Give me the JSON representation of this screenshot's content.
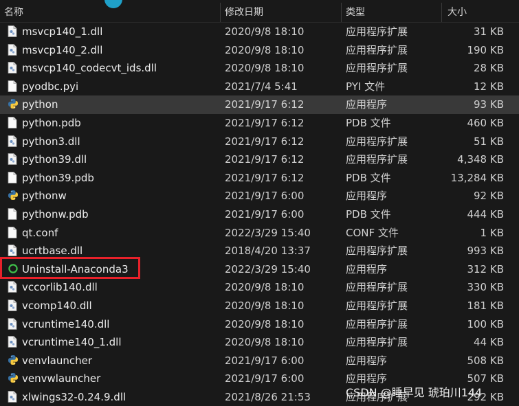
{
  "columns": {
    "name": "名称",
    "date": "修改日期",
    "type": "类型",
    "size": "大小"
  },
  "files": [
    {
      "name": "msvcp140_1.dll",
      "date": "2020/9/8 18:10",
      "type": "应用程序扩展",
      "size": "31 KB",
      "icon": "dll-file-icon"
    },
    {
      "name": "msvcp140_2.dll",
      "date": "2020/9/8 18:10",
      "type": "应用程序扩展",
      "size": "190 KB",
      "icon": "dll-file-icon"
    },
    {
      "name": "msvcp140_codecvt_ids.dll",
      "date": "2020/9/8 18:10",
      "type": "应用程序扩展",
      "size": "28 KB",
      "icon": "dll-file-icon"
    },
    {
      "name": "pyodbc.pyi",
      "date": "2021/7/4 5:41",
      "type": "PYI 文件",
      "size": "12 KB",
      "icon": "blank-file-icon"
    },
    {
      "name": "python",
      "date": "2021/9/17 6:12",
      "type": "应用程序",
      "size": "93 KB",
      "icon": "python-icon",
      "selected": true
    },
    {
      "name": "python.pdb",
      "date": "2021/9/17 6:12",
      "type": "PDB 文件",
      "size": "460 KB",
      "icon": "blank-file-icon"
    },
    {
      "name": "python3.dll",
      "date": "2021/9/17 6:12",
      "type": "应用程序扩展",
      "size": "51 KB",
      "icon": "dll-file-icon"
    },
    {
      "name": "python39.dll",
      "date": "2021/9/17 6:12",
      "type": "应用程序扩展",
      "size": "4,348 KB",
      "icon": "dll-file-icon"
    },
    {
      "name": "python39.pdb",
      "date": "2021/9/17 6:12",
      "type": "PDB 文件",
      "size": "13,284 KB",
      "icon": "blank-file-icon"
    },
    {
      "name": "pythonw",
      "date": "2021/9/17 6:00",
      "type": "应用程序",
      "size": "92 KB",
      "icon": "python-icon"
    },
    {
      "name": "pythonw.pdb",
      "date": "2021/9/17 6:00",
      "type": "PDB 文件",
      "size": "444 KB",
      "icon": "blank-file-icon"
    },
    {
      "name": "qt.conf",
      "date": "2022/3/29 15:40",
      "type": "CONF 文件",
      "size": "1 KB",
      "icon": "blank-file-icon"
    },
    {
      "name": "ucrtbase.dll",
      "date": "2018/4/20 13:37",
      "type": "应用程序扩展",
      "size": "993 KB",
      "icon": "dll-file-icon"
    },
    {
      "name": "Uninstall-Anaconda3",
      "date": "2022/3/29 15:40",
      "type": "应用程序",
      "size": "312 KB",
      "icon": "anaconda-ring-icon"
    },
    {
      "name": "vccorlib140.dll",
      "date": "2020/9/8 18:10",
      "type": "应用程序扩展",
      "size": "330 KB",
      "icon": "dll-file-icon"
    },
    {
      "name": "vcomp140.dll",
      "date": "2020/9/8 18:10",
      "type": "应用程序扩展",
      "size": "181 KB",
      "icon": "dll-file-icon"
    },
    {
      "name": "vcruntime140.dll",
      "date": "2020/9/8 18:10",
      "type": "应用程序扩展",
      "size": "100 KB",
      "icon": "dll-file-icon"
    },
    {
      "name": "vcruntime140_1.dll",
      "date": "2020/9/8 18:10",
      "type": "应用程序扩展",
      "size": "44 KB",
      "icon": "dll-file-icon"
    },
    {
      "name": "venvlauncher",
      "date": "2021/9/17 6:00",
      "type": "应用程序",
      "size": "508 KB",
      "icon": "python-icon"
    },
    {
      "name": "venvwlauncher",
      "date": "2021/9/17 6:00",
      "type": "应用程序",
      "size": "507 KB",
      "icon": "python-icon"
    },
    {
      "name": "xlwings32-0.24.9.dll",
      "date": "2021/8/26 21:53",
      "type": "应用程序扩展",
      "size": "292 KB",
      "icon": "dll-file-icon"
    }
  ],
  "watermark": "CSDN @睡早见 琥珀川144",
  "colors": {
    "background": "#191919",
    "selected_row": "#393939",
    "highlight_box": "#e8212a",
    "python_blue": "#3771a5",
    "python_yellow": "#f7c93e",
    "anaconda_green": "#3fbf4a"
  }
}
